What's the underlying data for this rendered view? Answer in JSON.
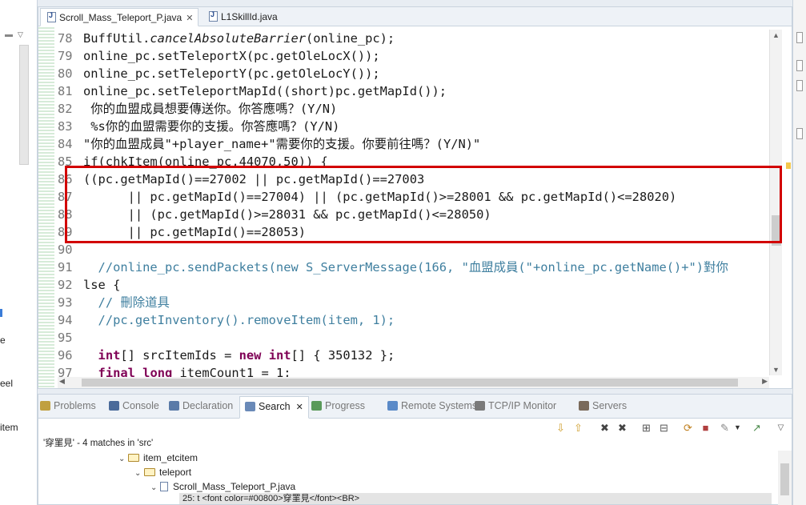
{
  "left_panel": {
    "fragments": [
      "e",
      "eel",
      "item"
    ]
  },
  "editor": {
    "tabs": [
      {
        "label": "Scroll_Mass_Teleport_P.java",
        "active": true
      },
      {
        "label": "L1SkillId.java",
        "active": false
      }
    ],
    "lines": [
      {
        "n": "78",
        "html": "BuffUtil.<span class=\"it\">cancelAbsoluteBarrier</span>(online_pc);"
      },
      {
        "n": "79",
        "html": "online_pc.setTeleportX(pc.getOleLocX());"
      },
      {
        "n": "80",
        "html": "online_pc.setTeleportY(pc.getOleLocY());"
      },
      {
        "n": "81",
        "html": "online_pc.setTeleportMapId((short)pc.getMapId());"
      },
      {
        "n": "82",
        "html": " 你的血盟成員想要傳送你。你答應嗎？(Y/N)"
      },
      {
        "n": "83",
        "html": " %s你的血盟需要你的支援。你答應嗎？(Y/N)"
      },
      {
        "n": "84",
        "html": "\"你的血盟成員\"+player_name+\"需要你的支援。你要前往嗎？(Y/N)\""
      },
      {
        "n": "85",
        "html": "if(chkItem(online_pc,44070,50)) {"
      },
      {
        "n": "86",
        "html": "((pc.getMapId()==27002 || pc.getMapId()==27003"
      },
      {
        "n": "87",
        "html": "      || pc.getMapId()==27004) || (pc.getMapId()>=28001 &amp;&amp; pc.getMapId()<=28020)"
      },
      {
        "n": "88",
        "html": "      || (pc.getMapId()>=28031 &amp;&amp; pc.getMapId()<=28050)"
      },
      {
        "n": "89",
        "html": "      || pc.getMapId()==28053)"
      },
      {
        "n": "90",
        "html": ""
      },
      {
        "n": "91",
        "html": "  <span class=\"cm\">//online_pc.sendPackets(new S_ServerMessage(166, \"血盟成員(\"+online_pc.getName()+\")對你</span>"
      },
      {
        "n": "92",
        "html": "lse {"
      },
      {
        "n": "93",
        "html": "  <span class=\"cm\">// 刪除道具</span>"
      },
      {
        "n": "94",
        "html": "  <span class=\"cm\">//pc.getInventory().removeItem(item, 1);</span>"
      },
      {
        "n": "95",
        "html": ""
      },
      {
        "n": "96",
        "html": "  <span class=\"kw\">int</span>[] srcItemIds = <span class=\"kw\">new</span> <span class=\"kw\">int</span>[] { 350132 };"
      },
      {
        "n": "97",
        "html": "  <span class=\"kw\">final</span> <span class=\"kw\">long</span> itemCount1 = 1;"
      }
    ]
  },
  "bottom_panel": {
    "tabs": [
      {
        "label": "Problems",
        "icon": "problems-icon",
        "color": "#c0a040"
      },
      {
        "label": "Console",
        "icon": "console-icon",
        "color": "#4a6a9a"
      },
      {
        "label": "Declaration",
        "icon": "declaration-icon",
        "color": "#5a7aa8"
      },
      {
        "label": "Search",
        "icon": "search-icon",
        "color": "#6a8ab8"
      },
      {
        "label": "Progress",
        "icon": "progress-icon",
        "color": "#5a9a5a"
      },
      {
        "label": "Remote Systems",
        "icon": "remote-systems-icon",
        "color": "#5a8ac8"
      },
      {
        "label": "TCP/IP Monitor",
        "icon": "tcpip-monitor-icon",
        "color": "#7a7a7a"
      },
      {
        "label": "Servers",
        "icon": "servers-icon",
        "color": "#7a6a5a"
      }
    ],
    "active_tab": "Search",
    "summary": "'穿罣見' - 4 matches in 'src'",
    "tree": [
      {
        "label": "item_etcitem",
        "type": "folder",
        "depth": 0
      },
      {
        "label": "teleport",
        "type": "folder",
        "depth": 1
      },
      {
        "label": "Scroll_Mass_Teleport_P.java",
        "type": "java",
        "depth": 2
      }
    ],
    "match_line": "25: t <font color=#00800>穿罣見</font><BR>"
  }
}
